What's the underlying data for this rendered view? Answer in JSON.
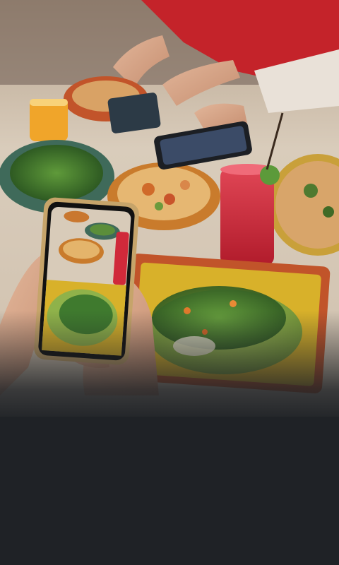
{
  "scene": {
    "subject": "people-photographing-food-with-smartphone",
    "colors": {
      "background": "#1f2226",
      "table": "#d9cdbd",
      "red_shirt": "#c4232a",
      "drink": "#d0293a",
      "greens": "#3f7a2e",
      "sauce": "#8fb24a",
      "plate_yellow": "#d8b12a"
    },
    "icons": [
      "phone-icon",
      "plate-icon",
      "glass-icon",
      "hand-icon"
    ]
  }
}
